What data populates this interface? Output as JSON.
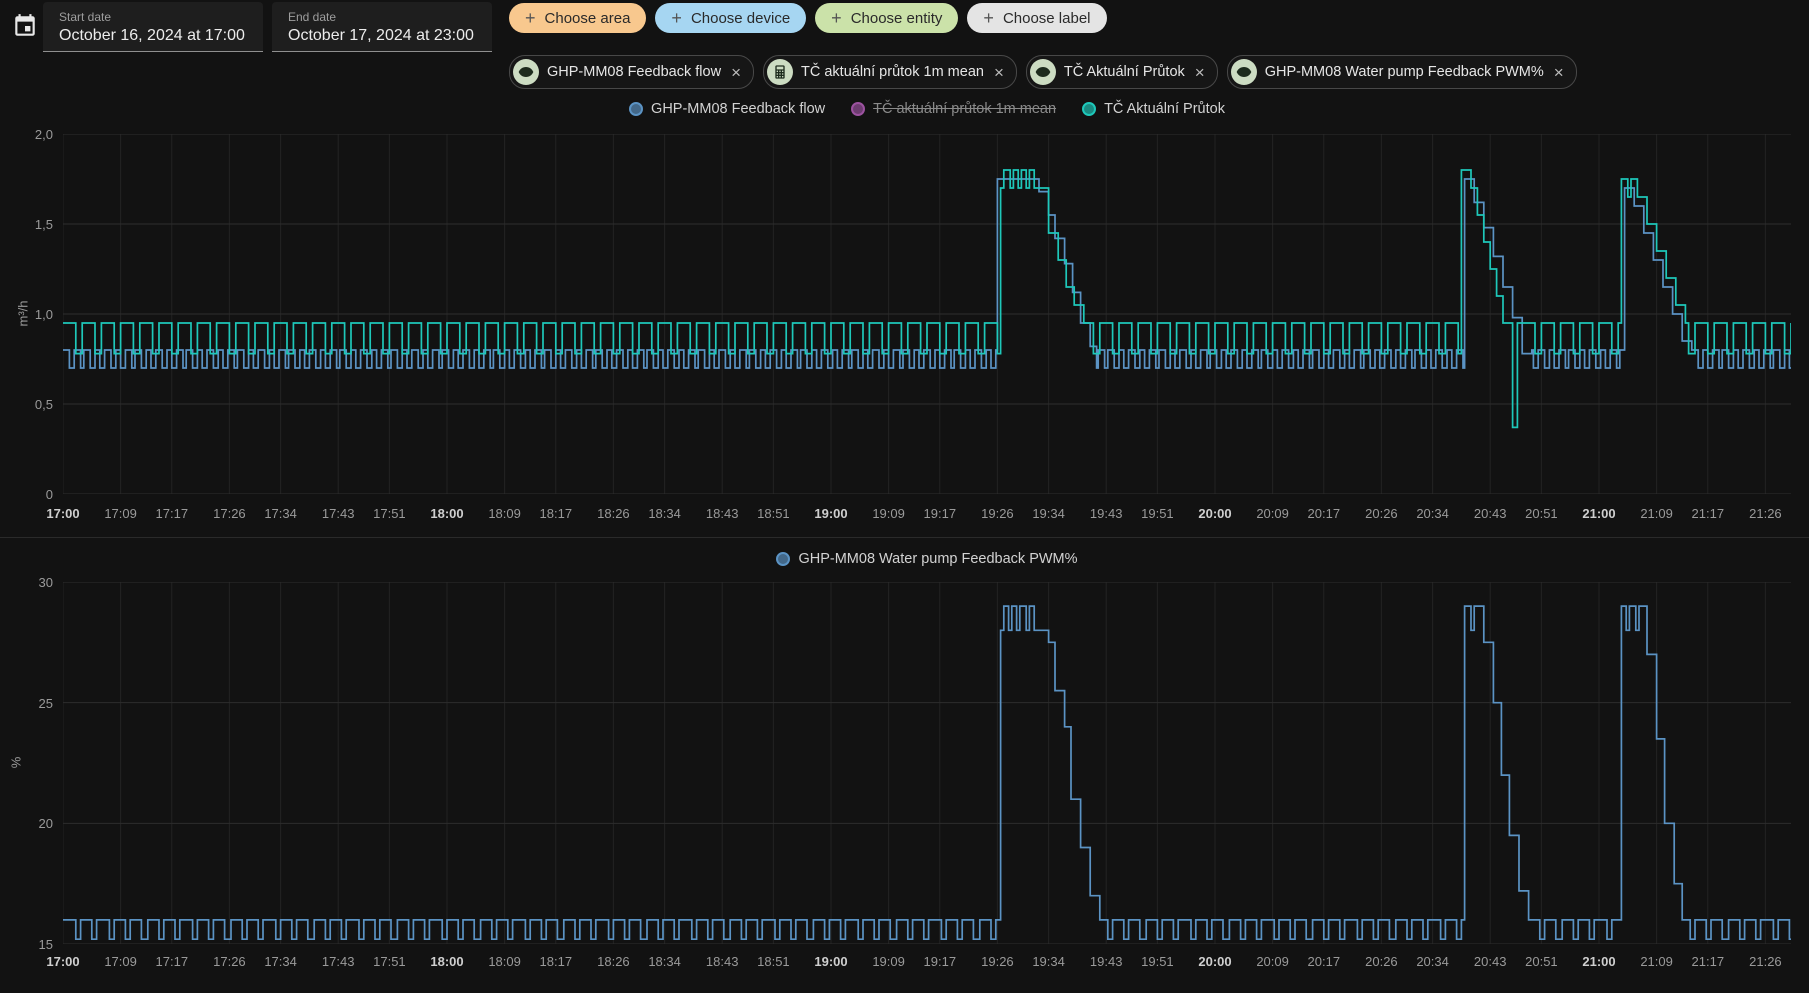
{
  "header": {
    "calendar_icon": "calendar-icon",
    "start_date": {
      "label": "Start date",
      "value": "October 16, 2024 at 17:00"
    },
    "end_date": {
      "label": "End date",
      "value": "October 17, 2024 at 23:00"
    },
    "filter_chips": [
      {
        "label": "Choose area",
        "icon": "plus",
        "bg": "#f8c88e"
      },
      {
        "label": "Choose device",
        "icon": "plus",
        "bg": "#a6d6f2"
      },
      {
        "label": "Choose entity",
        "icon": "plus",
        "bg": "#cbe2a9"
      },
      {
        "label": "Choose label",
        "icon": "plus",
        "bg": "#e4e4e4"
      }
    ],
    "entity_chips": [
      {
        "label": "GHP-MM08 Feedback flow",
        "icon": "eye",
        "close": "×"
      },
      {
        "label": "TČ aktuální průtok 1m mean",
        "icon": "calculator",
        "close": "×"
      },
      {
        "label": "TČ Aktuální Průtok",
        "icon": "eye",
        "close": "×"
      },
      {
        "label": "GHP-MM08 Water pump Feedback PWM%",
        "icon": "eye",
        "close": "×"
      }
    ]
  },
  "chart_data": [
    {
      "type": "line",
      "subtype": "step",
      "title": "",
      "xlabel": "",
      "ylabel": "m³/h",
      "ylim": [
        0,
        2.0
      ],
      "grid": true,
      "legend_position": "top-center",
      "yticks": [
        {
          "v": 2.0,
          "label": "2,0"
        },
        {
          "v": 1.5,
          "label": "1,5"
        },
        {
          "v": 1.0,
          "label": "1,0"
        },
        {
          "v": 0.5,
          "label": "0,5"
        },
        {
          "v": 0.0,
          "label": "0"
        }
      ],
      "x_start_label": "17:00",
      "x_minutes": 270,
      "xticks": [
        {
          "t": 0,
          "label": "17:00",
          "bold": true
        },
        {
          "t": 9,
          "label": "17:09",
          "bold": false
        },
        {
          "t": 17,
          "label": "17:17",
          "bold": false
        },
        {
          "t": 26,
          "label": "17:26",
          "bold": false
        },
        {
          "t": 34,
          "label": "17:34",
          "bold": false
        },
        {
          "t": 43,
          "label": "17:43",
          "bold": false
        },
        {
          "t": 51,
          "label": "17:51",
          "bold": false
        },
        {
          "t": 60,
          "label": "18:00",
          "bold": true
        },
        {
          "t": 69,
          "label": "18:09",
          "bold": false
        },
        {
          "t": 77,
          "label": "18:17",
          "bold": false
        },
        {
          "t": 86,
          "label": "18:26",
          "bold": false
        },
        {
          "t": 94,
          "label": "18:34",
          "bold": false
        },
        {
          "t": 103,
          "label": "18:43",
          "bold": false
        },
        {
          "t": 111,
          "label": "18:51",
          "bold": false
        },
        {
          "t": 120,
          "label": "19:00",
          "bold": true
        },
        {
          "t": 129,
          "label": "19:09",
          "bold": false
        },
        {
          "t": 137,
          "label": "19:17",
          "bold": false
        },
        {
          "t": 146,
          "label": "19:26",
          "bold": false
        },
        {
          "t": 154,
          "label": "19:34",
          "bold": false
        },
        {
          "t": 163,
          "label": "19:43",
          "bold": false
        },
        {
          "t": 171,
          "label": "19:51",
          "bold": false
        },
        {
          "t": 180,
          "label": "20:00",
          "bold": true
        },
        {
          "t": 189,
          "label": "20:09",
          "bold": false
        },
        {
          "t": 197,
          "label": "20:17",
          "bold": false
        },
        {
          "t": 206,
          "label": "20:26",
          "bold": false
        },
        {
          "t": 214,
          "label": "20:34",
          "bold": false
        },
        {
          "t": 223,
          "label": "20:43",
          "bold": false
        },
        {
          "t": 231,
          "label": "20:51",
          "bold": false
        },
        {
          "t": 240,
          "label": "21:00",
          "bold": true
        },
        {
          "t": 249,
          "label": "21:09",
          "bold": false
        },
        {
          "t": 257,
          "label": "21:17",
          "bold": false
        },
        {
          "t": 266,
          "label": "21:26",
          "bold": false
        }
      ],
      "series": [
        {
          "name": "GHP-MM08 Feedback flow",
          "color": "#5b93c4",
          "hidden": false,
          "baseline": {
            "high": 0.8,
            "low": 0.7,
            "period": 1.6,
            "high_duration": 0.9
          },
          "peaks": [
            {
              "end": 161.5,
              "points": [
                [
                  145.8,
                  1.75
                ],
                [
                  152.5,
                  1.68
                ],
                [
                  153.8,
                  1.55
                ],
                [
                  155,
                  1.42
                ],
                [
                  156.3,
                  1.28
                ],
                [
                  157.6,
                  1.12
                ],
                [
                  159,
                  0.95
                ],
                [
                  160.3,
                  0.82
                ]
              ]
            },
            {
              "end": 229.5,
              "points": [
                [
                  219,
                  1.75
                ],
                [
                  220.5,
                  1.62
                ],
                [
                  222,
                  1.48
                ],
                [
                  223.5,
                  1.32
                ],
                [
                  225,
                  1.15
                ],
                [
                  226.5,
                  0.98
                ],
                [
                  228,
                  0.78
                ]
              ]
            },
            {
              "end": 254.5,
              "points": [
                [
                  244,
                  1.7
                ],
                [
                  245.5,
                  1.6
                ],
                [
                  247,
                  1.45
                ],
                [
                  248.5,
                  1.3
                ],
                [
                  250,
                  1.15
                ],
                [
                  251.5,
                  1.0
                ],
                [
                  253,
                  0.85
                ]
              ]
            }
          ]
        },
        {
          "name": "TČ aktuální průtok 1m mean",
          "color": "#9c52a0",
          "hidden": true,
          "baseline": null,
          "peaks": []
        },
        {
          "name": "TČ Aktuální Průtok",
          "color": "#1ec8ba",
          "hidden": false,
          "baseline": {
            "high": 0.95,
            "low": 0.78,
            "period": 3,
            "high_duration": 2
          },
          "peaks": [
            {
              "end": 159.5,
              "points": [
                [
                  146.5,
                  1.7
                ],
                [
                  147,
                  1.8
                ],
                [
                  147.8,
                  1.7
                ],
                [
                  148.3,
                  1.8
                ],
                [
                  149.1,
                  1.7
                ],
                [
                  149.6,
                  1.8
                ],
                [
                  150.4,
                  1.7
                ],
                [
                  150.9,
                  1.8
                ],
                [
                  151.7,
                  1.7
                ],
                [
                  154,
                  1.45
                ],
                [
                  155.3,
                  1.3
                ],
                [
                  156.6,
                  1.15
                ],
                [
                  158,
                  1.05
                ]
              ]
            },
            {
              "end": 228,
              "points": [
                [
                  218.5,
                  1.8
                ],
                [
                  220,
                  1.7
                ],
                [
                  221,
                  1.55
                ],
                [
                  222,
                  1.4
                ],
                [
                  223,
                  1.25
                ],
                [
                  224,
                  1.1
                ],
                [
                  225,
                  0.95
                ],
                [
                  226.5,
                  0.37
                ],
                [
                  227.2,
                  0.95
                ]
              ]
            },
            {
              "end": 253.5,
              "points": [
                [
                  243.5,
                  1.75
                ],
                [
                  244.5,
                  1.65
                ],
                [
                  245,
                  1.75
                ],
                [
                  246,
                  1.65
                ],
                [
                  247.5,
                  1.5
                ],
                [
                  249,
                  1.35
                ],
                [
                  250.5,
                  1.2
                ],
                [
                  252,
                  1.05
                ]
              ]
            }
          ]
        }
      ]
    },
    {
      "type": "line",
      "subtype": "step",
      "title": "",
      "xlabel": "",
      "ylabel": "%",
      "ylim": [
        15,
        30
      ],
      "grid": true,
      "legend_position": "top-center",
      "yticks": [
        {
          "v": 30,
          "label": "30"
        },
        {
          "v": 25,
          "label": "25"
        },
        {
          "v": 20,
          "label": "20"
        },
        {
          "v": 15,
          "label": "15"
        }
      ],
      "x_start_label": "17:00",
      "x_minutes": 270,
      "xticks": [
        {
          "t": 0,
          "label": "17:00",
          "bold": true
        },
        {
          "t": 9,
          "label": "17:09",
          "bold": false
        },
        {
          "t": 17,
          "label": "17:17",
          "bold": false
        },
        {
          "t": 26,
          "label": "17:26",
          "bold": false
        },
        {
          "t": 34,
          "label": "17:34",
          "bold": false
        },
        {
          "t": 43,
          "label": "17:43",
          "bold": false
        },
        {
          "t": 51,
          "label": "17:51",
          "bold": false
        },
        {
          "t": 60,
          "label": "18:00",
          "bold": true
        },
        {
          "t": 69,
          "label": "18:09",
          "bold": false
        },
        {
          "t": 77,
          "label": "18:17",
          "bold": false
        },
        {
          "t": 86,
          "label": "18:26",
          "bold": false
        },
        {
          "t": 94,
          "label": "18:34",
          "bold": false
        },
        {
          "t": 103,
          "label": "18:43",
          "bold": false
        },
        {
          "t": 111,
          "label": "18:51",
          "bold": false
        },
        {
          "t": 120,
          "label": "19:00",
          "bold": true
        },
        {
          "t": 129,
          "label": "19:09",
          "bold": false
        },
        {
          "t": 137,
          "label": "19:17",
          "bold": false
        },
        {
          "t": 146,
          "label": "19:26",
          "bold": false
        },
        {
          "t": 154,
          "label": "19:34",
          "bold": false
        },
        {
          "t": 163,
          "label": "19:43",
          "bold": false
        },
        {
          "t": 171,
          "label": "19:51",
          "bold": false
        },
        {
          "t": 180,
          "label": "20:00",
          "bold": true
        },
        {
          "t": 189,
          "label": "20:09",
          "bold": false
        },
        {
          "t": 197,
          "label": "20:17",
          "bold": false
        },
        {
          "t": 206,
          "label": "20:26",
          "bold": false
        },
        {
          "t": 214,
          "label": "20:34",
          "bold": false
        },
        {
          "t": 223,
          "label": "20:43",
          "bold": false
        },
        {
          "t": 231,
          "label": "20:51",
          "bold": false
        },
        {
          "t": 240,
          "label": "21:00",
          "bold": true
        },
        {
          "t": 249,
          "label": "21:09",
          "bold": false
        },
        {
          "t": 257,
          "label": "21:17",
          "bold": false
        },
        {
          "t": 266,
          "label": "21:26",
          "bold": false
        }
      ],
      "series": [
        {
          "name": "GHP-MM08 Water pump Feedback PWM%",
          "color": "#5b93c4",
          "hidden": false,
          "baseline": {
            "high": 16,
            "low": 15.2,
            "period": 2.6,
            "high_duration": 1.8
          },
          "peaks": [
            {
              "end": 162,
              "points": [
                [
                  146.5,
                  28
                ],
                [
                  146.9,
                  29
                ],
                [
                  147.7,
                  28
                ],
                [
                  148.2,
                  29
                ],
                [
                  149,
                  28
                ],
                [
                  149.5,
                  29
                ],
                [
                  150.3,
                  28
                ],
                [
                  150.8,
                  29
                ],
                [
                  151.6,
                  28
                ],
                [
                  154,
                  27.5
                ],
                [
                  155,
                  25.5
                ],
                [
                  156.3,
                  24
                ],
                [
                  157.5,
                  21
                ],
                [
                  159,
                  19
                ],
                [
                  160.5,
                  17
                ]
              ]
            },
            {
              "end": 229,
              "points": [
                [
                  219,
                  29
                ],
                [
                  220,
                  28
                ],
                [
                  220.5,
                  29
                ],
                [
                  222,
                  27.5
                ],
                [
                  223.3,
                  25
                ],
                [
                  224.6,
                  22
                ],
                [
                  226,
                  19.5
                ],
                [
                  227.5,
                  17.2
                ]
              ]
            },
            {
              "end": 253,
              "points": [
                [
                  243.5,
                  29
                ],
                [
                  244.2,
                  28
                ],
                [
                  244.7,
                  29
                ],
                [
                  245.7,
                  28
                ],
                [
                  246.2,
                  29
                ],
                [
                  247.5,
                  27
                ],
                [
                  248.8,
                  23.5
                ],
                [
                  250.2,
                  20
                ],
                [
                  251.6,
                  17.5
                ]
              ]
            }
          ]
        }
      ]
    }
  ]
}
